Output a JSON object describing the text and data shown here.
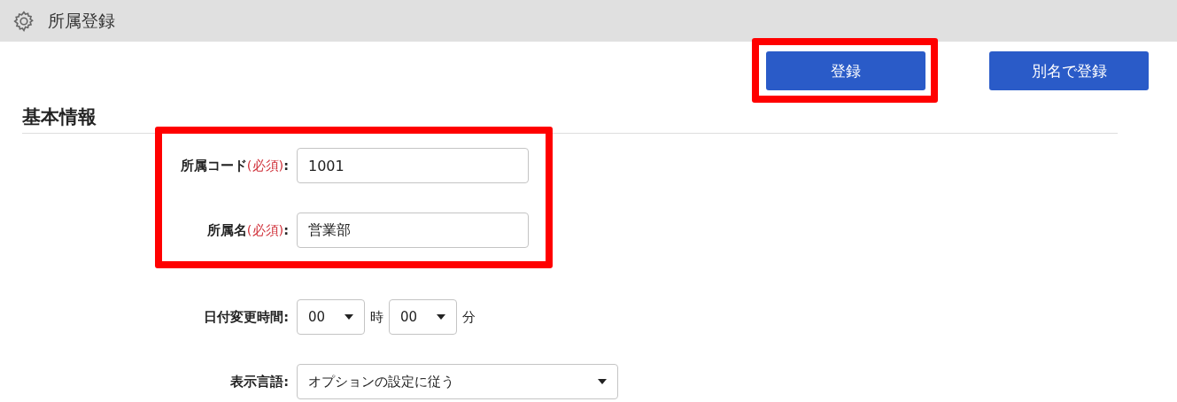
{
  "header": {
    "title": "所属登録"
  },
  "toolbar": {
    "buttons": [
      {
        "label": "登録",
        "highlighted": true
      },
      {
        "label": "別名で登録",
        "highlighted": false
      }
    ]
  },
  "section": {
    "title": "基本情報"
  },
  "field_groups": [
    {
      "highlighted": true,
      "fields": [
        {
          "kind": "text",
          "label": "所属コード",
          "note": "(必須)",
          "suffix": ":",
          "value": "1001"
        },
        {
          "kind": "text",
          "label": "所属名",
          "note": "(必須)",
          "suffix": ":",
          "value": "営業部"
        }
      ]
    },
    {
      "highlighted": false,
      "fields": [
        {
          "kind": "time",
          "label": "日付変更時間:",
          "hours": "00",
          "hours_unit": "時",
          "minutes": "00",
          "minutes_unit": "分"
        },
        {
          "kind": "select",
          "label": "表示言語:",
          "value": "オプションの設定に従う"
        }
      ]
    }
  ]
}
